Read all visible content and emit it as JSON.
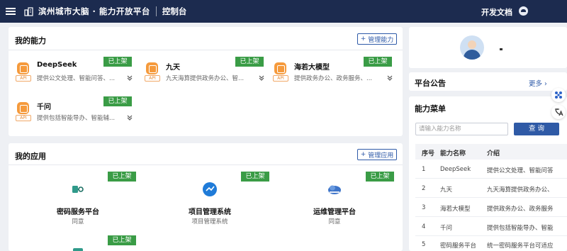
{
  "header": {
    "title": "滨州城市大脑 · 能力开放平台",
    "console": "控制台",
    "docs": "开发文档"
  },
  "capabilities": {
    "title": "我的能力",
    "manage_label": "管理能力",
    "items": [
      {
        "name": "DeepSeek",
        "desc": "提供公文处理、智能问答、...",
        "tag": "已上架",
        "badge": "API"
      },
      {
        "name": "九天",
        "desc": "九天海算提供政务办公、智...",
        "tag": "已上架",
        "badge": "API"
      },
      {
        "name": "海若大模型",
        "desc": "提供政务办公、政务服务、...",
        "tag": "已上架",
        "badge": "API"
      },
      {
        "name": "千问",
        "desc": "提供包括智能导办、智能辅...",
        "tag": "已上架",
        "badge": "API"
      }
    ]
  },
  "applications": {
    "title": "我的应用",
    "manage_label": "管理应用",
    "items": [
      {
        "name": "密码服务平台",
        "sub": "同意",
        "tag": "已上架"
      },
      {
        "name": "项目管理系统",
        "sub": "项目管理系统",
        "tag": "已上架"
      },
      {
        "name": "运维管理平台",
        "sub": "同意",
        "tag": "已上架"
      },
      {
        "name": "",
        "sub": "",
        "tag": "已上架"
      }
    ]
  },
  "notice": {
    "title": "平台公告",
    "more": "更多 ›"
  },
  "menu": {
    "title": "能力菜单",
    "search_placeholder": "请输入能力名称",
    "search_button": "查 询",
    "columns": [
      "序号",
      "能力名称",
      "介绍"
    ],
    "rows": [
      {
        "no": "1",
        "name": "DeepSeek",
        "intro": "提供公文处理、智能问答"
      },
      {
        "no": "2",
        "name": "九天",
        "intro": "九天海算提供政务办公、"
      },
      {
        "no": "3",
        "name": "海若大模型",
        "intro": "提供政务办公、政务服务"
      },
      {
        "no": "4",
        "name": "千问",
        "intro": "提供包括智能导办、智能"
      },
      {
        "no": "5",
        "name": "密码服务平台",
        "intro": "统一密码服务平台可适应"
      }
    ]
  },
  "colors": {
    "topbar": "#1c2b4f",
    "tag_green": "#3a9c46",
    "accent_blue": "#2e5aa8",
    "api_orange": "#f59a3c"
  }
}
